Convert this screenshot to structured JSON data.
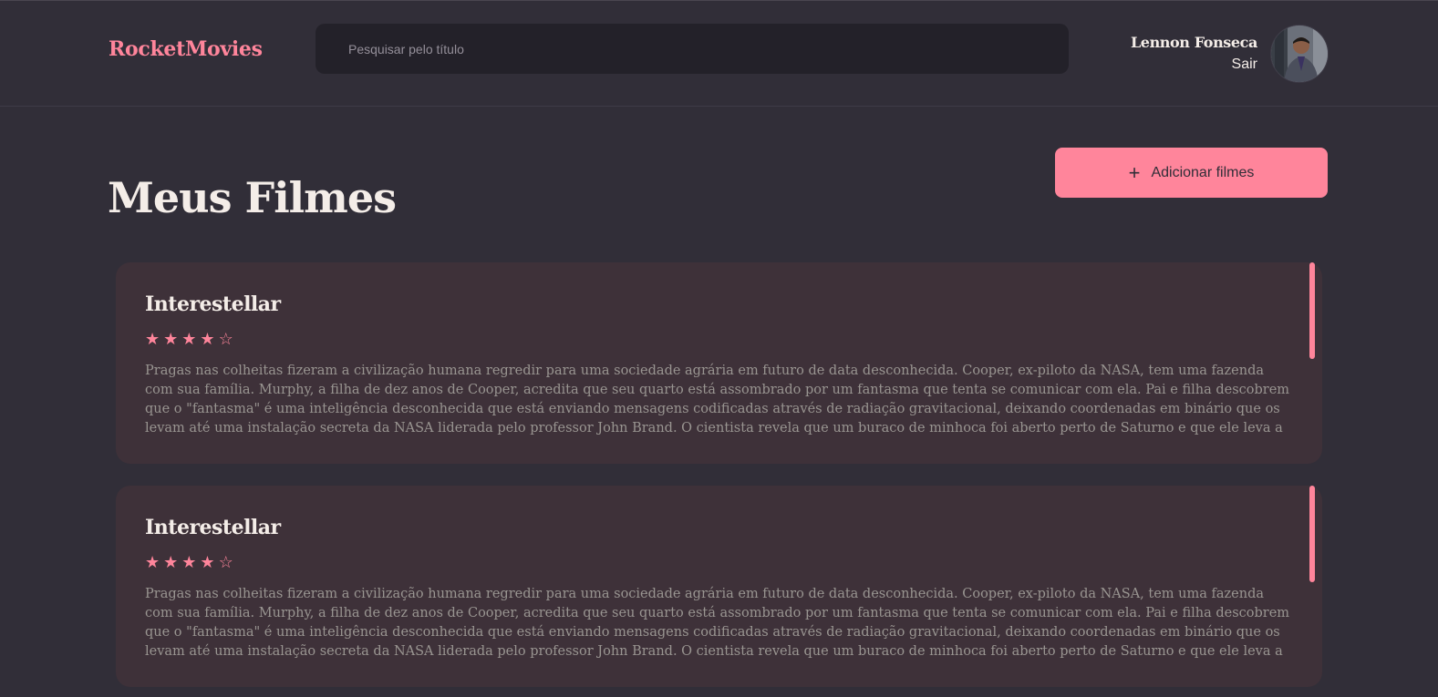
{
  "header": {
    "brand": "RocketMovies",
    "search_placeholder": "Pesquisar pelo título",
    "user_name": "Lennon Fonseca",
    "logout_label": "Sair"
  },
  "main": {
    "title": "Meus Filmes",
    "add_button_label": "Adicionar filmes",
    "add_button_icon": "plus-icon"
  },
  "movies": [
    {
      "title": "Interestellar",
      "rating": 4,
      "rating_max": 5,
      "description": "Pragas nas colheitas fizeram a civilização humana regredir para uma sociedade agrária em futuro de data desconhecida. Cooper, ex-piloto da NASA, tem uma fazenda com sua família. Murphy, a filha de dez anos de Cooper, acredita que seu quarto está assombrado por um fantasma que tenta se comunicar com ela. Pai e filha descobrem que o \"fantasma\" é uma inteligência desconhecida que está enviando mensagens codificadas através de radiação gravitacional, deixando coordenadas em binário que os levam até uma instalação secreta da NASA liderada pelo professor John Brand. O cientista revela que um buraco de minhoca foi aberto perto de Saturno e que ele leva a planetas que podem oferecer condições de sobrevivência para a espécie humana. As \"missões Lázaro\" enviadas anos antes identificaram três planetas"
    },
    {
      "title": "Interestellar",
      "rating": 4,
      "rating_max": 5,
      "description": "Pragas nas colheitas fizeram a civilização humana regredir para uma sociedade agrária em futuro de data desconhecida. Cooper, ex-piloto da NASA, tem uma fazenda com sua família. Murphy, a filha de dez anos de Cooper, acredita que seu quarto está assombrado por um fantasma que tenta se comunicar com ela. Pai e filha descobrem que o \"fantasma\" é uma inteligência desconhecida que está enviando mensagens codificadas através de radiação gravitacional, deixando coordenadas em binário que os levam até uma instalação secreta da NASA liderada pelo professor John Brand. O cientista revela que um buraco de minhoca foi aberto perto de Saturno e que ele leva a planetas que podem oferecer condições de sobrevivência para a espécie humana. As \"missões Lázaro\" enviadas anos antes identificaram três planetas"
    }
  ],
  "colors": {
    "background": "#312E38",
    "accent": "#FF859B",
    "card": "#3E3139",
    "input": "#232129",
    "text": "#F4EDE8",
    "muted": "#999591"
  }
}
